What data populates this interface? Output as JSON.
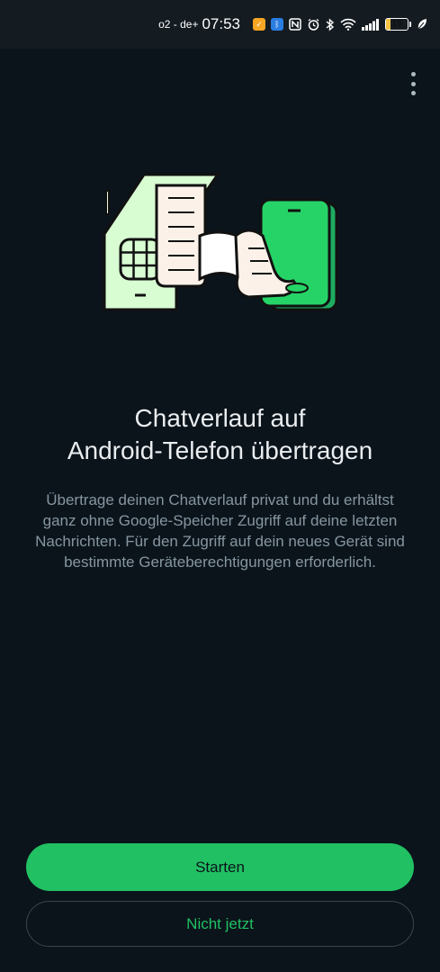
{
  "status_bar": {
    "carrier": "o2 - de+",
    "time": "07:53",
    "battery": "19",
    "battery_level": 0.19,
    "icons": [
      "app-notification-icon",
      "bluetooth-app-icon",
      "nfc-icon",
      "alarm-icon",
      "bluetooth-icon",
      "wifi-icon",
      "signal-icon",
      "battery-icon",
      "leaf-icon"
    ]
  },
  "header": {
    "menu_icon": "more-vert-icon"
  },
  "illustration": {
    "name": "chat-transfer-illustration"
  },
  "content": {
    "title": "Chatverlauf auf\nAndroid-Telefon übertragen",
    "description": "Übertrage deinen Chatverlauf privat und du erhältst ganz ohne Google-Speicher Zugriff auf deine letzten Nachrichten. Für den Zugriff auf dein neues Gerät sind bestimmte Geräteberechtigungen erforderlich."
  },
  "actions": {
    "primary_label": "Starten",
    "secondary_label": "Nicht jetzt"
  },
  "colors": {
    "background": "#0b141b",
    "accent": "#21c063",
    "text_primary": "#e9edef",
    "text_secondary": "#8696a0"
  }
}
